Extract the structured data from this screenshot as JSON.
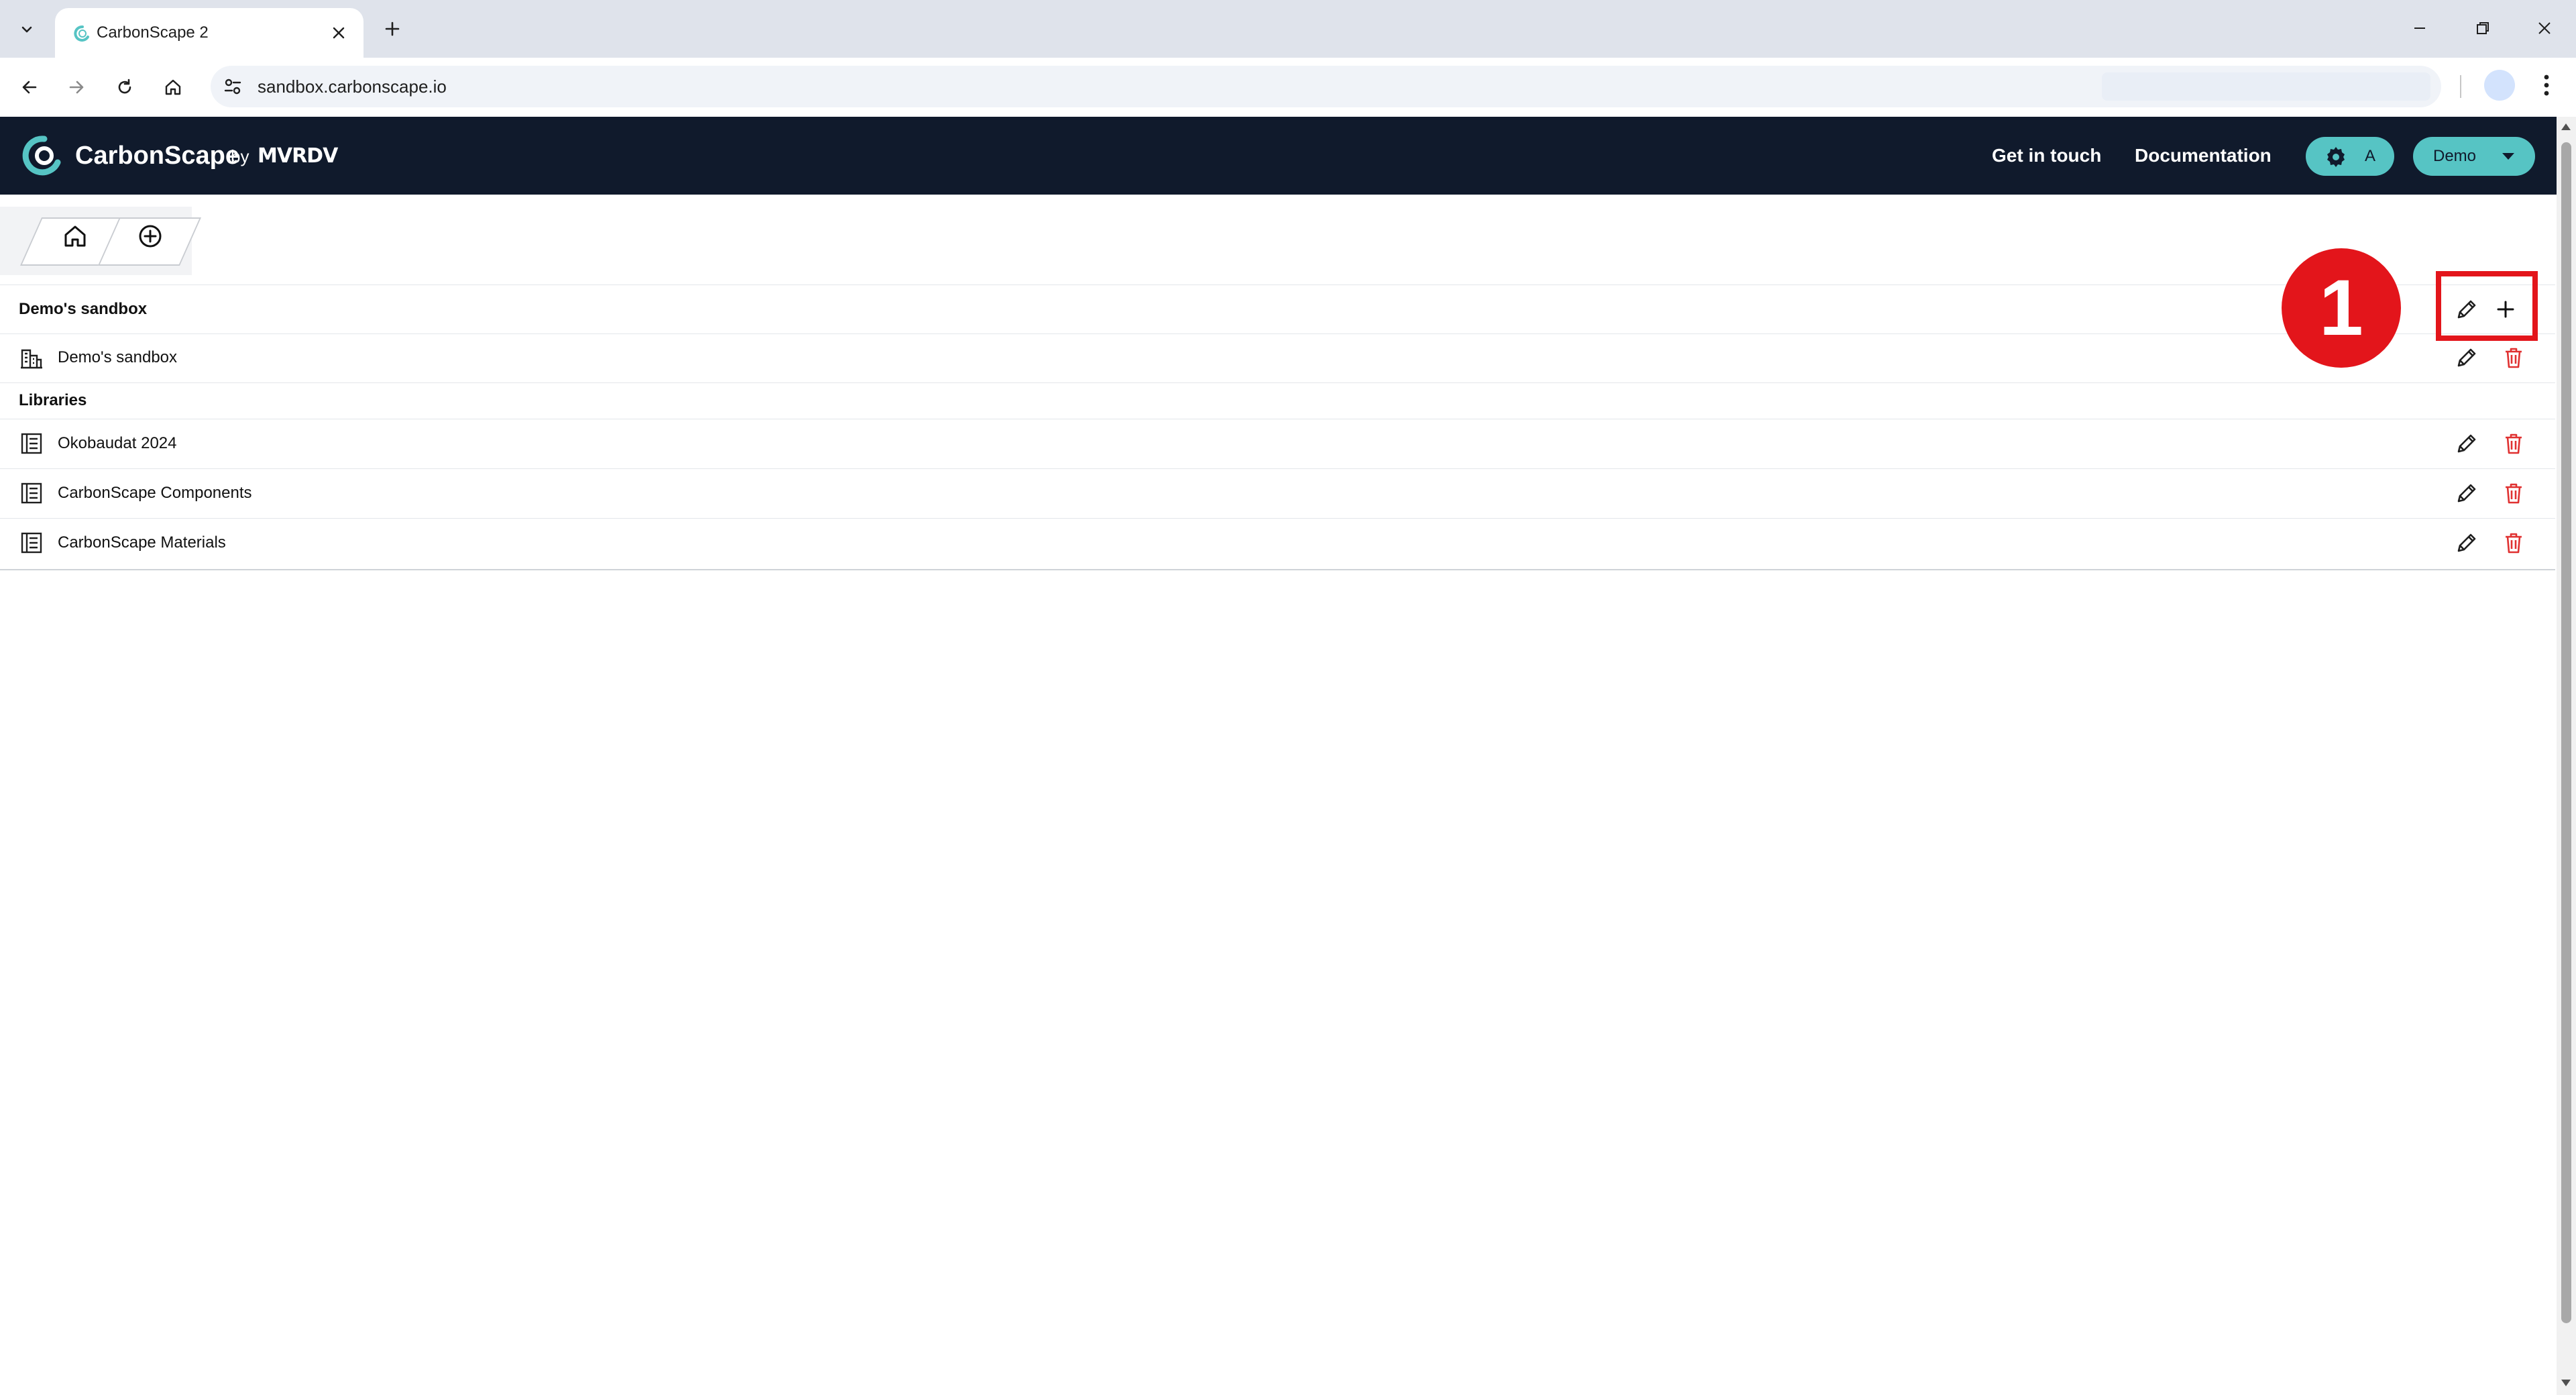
{
  "browser": {
    "tab_title": "CarbonScape 2",
    "url": "sandbox.carbonscape.io"
  },
  "header": {
    "brand": "CarbonScape",
    "brand_by": "by",
    "brand_partner": "MVRDV",
    "links": [
      "Get in touch",
      "Documentation"
    ],
    "settings_label": "A",
    "user_menu_label": "Demo",
    "bg_color": "#101a2c",
    "accent_color": "#56c4c4"
  },
  "breadcrumb": {
    "items": [
      "home-icon",
      "add-circle-icon"
    ]
  },
  "workspace": {
    "section_title": "Demo's sandbox",
    "items": [
      {
        "label": "Demo's sandbox",
        "icon": "building-icon"
      }
    ]
  },
  "libraries": {
    "section_title": "Libraries",
    "items": [
      {
        "label": "Okobaudat 2024",
        "icon": "document-icon"
      },
      {
        "label": "CarbonScape Components",
        "icon": "document-icon"
      },
      {
        "label": "CarbonScape Materials",
        "icon": "document-icon"
      }
    ]
  },
  "annotation": {
    "badge_number": "1",
    "color": "#e3151b"
  }
}
